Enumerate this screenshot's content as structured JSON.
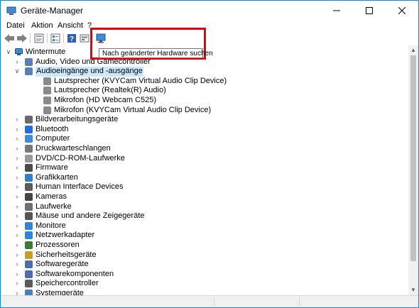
{
  "window": {
    "title": "Geräte-Manager",
    "controls": {
      "minimize": "—",
      "maximize": "☐",
      "close": "✕"
    }
  },
  "menubar": {
    "items": [
      {
        "label": "Datei"
      },
      {
        "label": "Aktion"
      },
      {
        "label": "Ansicht"
      },
      {
        "label": "?"
      }
    ]
  },
  "toolbar": {
    "buttons": [
      {
        "icon": "back-arrow-icon"
      },
      {
        "icon": "forward-arrow-icon"
      },
      {
        "icon": "properties-icon"
      },
      {
        "icon": "device-list-icon"
      },
      {
        "icon": "help-icon"
      },
      {
        "icon": "driver-icon"
      },
      {
        "icon": "scan-hardware-icon"
      }
    ],
    "tooltip": "Nach geänderter Hardware suchen"
  },
  "tree": {
    "root": "Wintermute",
    "items": [
      {
        "label": "Audio, Video und Gamecontroller",
        "level": 1,
        "expanded": false,
        "icon": "speaker-icon",
        "color": "#5a7fb4"
      },
      {
        "label": "Audioeingänge und -ausgänge",
        "level": 1,
        "expanded": true,
        "selected": true,
        "icon": "speaker-icon",
        "color": "#5a7fb4"
      },
      {
        "label": "Lautsprecher (KVYCam Virtual Audio Clip Device)",
        "level": 2,
        "icon": "speaker-icon",
        "color": "#8a8a8a"
      },
      {
        "label": "Lautsprecher (Realtek(R) Audio)",
        "level": 2,
        "icon": "speaker-icon",
        "color": "#8a8a8a"
      },
      {
        "label": "Mikrofon (HD Webcam C525)",
        "level": 2,
        "icon": "microphone-icon",
        "color": "#8a8a8a"
      },
      {
        "label": "Mikrofon (KVYCam Virtual Audio Clip Device)",
        "level": 2,
        "icon": "microphone-icon",
        "color": "#8a8a8a"
      },
      {
        "label": "Bildverarbeitungsgeräte",
        "level": 1,
        "icon": "camera-icon",
        "color": "#6a6a6a"
      },
      {
        "label": "Bluetooth",
        "level": 1,
        "icon": "bluetooth-icon",
        "color": "#1e6fd9"
      },
      {
        "label": "Computer",
        "level": 1,
        "icon": "computer-icon",
        "color": "#3c8dd6"
      },
      {
        "label": "Druckwarteschlangen",
        "level": 1,
        "icon": "printer-icon",
        "color": "#777777"
      },
      {
        "label": "DVD/CD-ROM-Laufwerke",
        "level": 1,
        "icon": "disc-icon",
        "color": "#9a9a9a"
      },
      {
        "label": "Firmware",
        "level": 1,
        "icon": "chip-icon",
        "color": "#4a4a4a"
      },
      {
        "label": "Grafikkarten",
        "level": 1,
        "icon": "display-adapter-icon",
        "color": "#2f7fc9"
      },
      {
        "label": "Human Interface Devices",
        "level": 1,
        "icon": "hid-icon",
        "color": "#5b5b5b"
      },
      {
        "label": "Kameras",
        "level": 1,
        "icon": "webcam-icon",
        "color": "#444444"
      },
      {
        "label": "Laufwerke",
        "level": 1,
        "icon": "drive-icon",
        "color": "#6f6f6f"
      },
      {
        "label": "Mäuse und andere Zeigegeräte",
        "level": 1,
        "icon": "mouse-icon",
        "color": "#555555"
      },
      {
        "label": "Monitore",
        "level": 1,
        "icon": "monitor-icon",
        "color": "#2f86d6"
      },
      {
        "label": "Netzwerkadapter",
        "level": 1,
        "icon": "network-icon",
        "color": "#2f86d6"
      },
      {
        "label": "Prozessoren",
        "level": 1,
        "icon": "processor-icon",
        "color": "#3a7a3a"
      },
      {
        "label": "Sicherheitsgeräte",
        "level": 1,
        "icon": "security-key-icon",
        "color": "#c8a020"
      },
      {
        "label": "Softwaregeräte",
        "level": 1,
        "icon": "software-device-icon",
        "color": "#4a6fa8"
      },
      {
        "label": "Softwarekomponenten",
        "level": 1,
        "icon": "software-component-icon",
        "color": "#4a6fa8"
      },
      {
        "label": "Speichercontroller",
        "level": 1,
        "icon": "storage-controller-icon",
        "color": "#5a5a5a"
      },
      {
        "label": "Systemgeräte",
        "level": 1,
        "icon": "system-device-icon",
        "color": "#4d7bbf"
      }
    ]
  },
  "colors": {
    "accent": "#1883d7",
    "selection": "#cce8ff",
    "highlight_box": "#e8000c"
  }
}
